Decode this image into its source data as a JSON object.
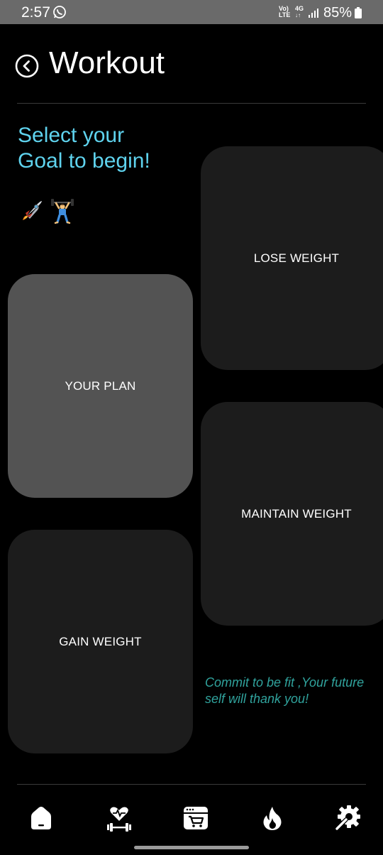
{
  "status_bar": {
    "time": "2:57",
    "network_top": "Vo)",
    "network_bottom": "LTE",
    "network_type": "4G",
    "battery": "85%"
  },
  "header": {
    "title": "Workout"
  },
  "prompt": {
    "line1": "Select your",
    "line2": "Goal to begin!"
  },
  "emojis": [
    "rocket",
    "weight-lifter"
  ],
  "goals": {
    "your_plan": "YOUR PLAN",
    "lose_weight": "LOSE WEIGHT",
    "maintain_weight": "MAINTAIN WEIGHT",
    "gain_weight": "GAIN WEIGHT"
  },
  "quote": {
    "line1": "Commit to be fit ,Your future",
    "line2": "self will thank you!"
  },
  "bottom_nav": {
    "icons": [
      "home-icon",
      "heart-dumbbell-icon",
      "shop-cart-icon",
      "flame-icon",
      "gear-wrench-icon"
    ]
  },
  "colors": {
    "accent": "#5fd3ee",
    "quote": "#30a39d",
    "card": "#1c1c1c",
    "card_active": "#535353"
  }
}
